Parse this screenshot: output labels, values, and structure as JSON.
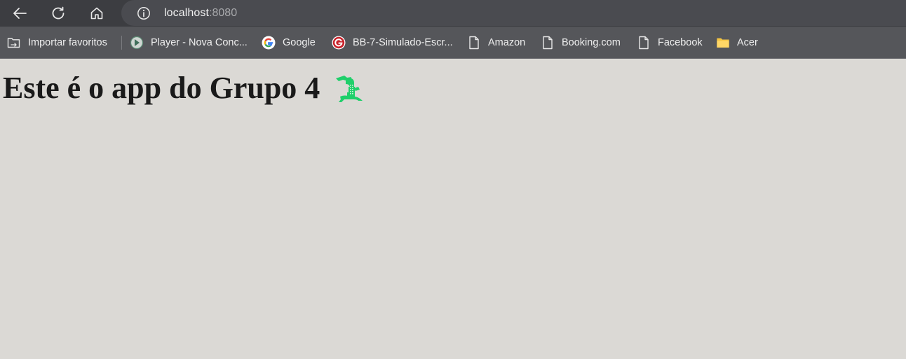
{
  "browser": {
    "url_host": "localhost",
    "url_port": ":8080",
    "icons": {
      "back": "arrow-left-icon",
      "reload": "reload-icon",
      "home": "home-icon",
      "site_info": "info-icon"
    }
  },
  "bookmarks": {
    "items": [
      {
        "label": "Importar favoritos",
        "icon": "import-bookmarks-icon"
      },
      {
        "label": "Player - Nova Conc...",
        "icon": "player-favicon-icon"
      },
      {
        "label": "Google",
        "icon": "google-icon"
      },
      {
        "label": "BB-7-Simulado-Escr...",
        "icon": "g-red-favicon-icon"
      },
      {
        "label": "Amazon",
        "icon": "page-icon"
      },
      {
        "label": "Booking.com",
        "icon": "page-icon"
      },
      {
        "label": "Facebook",
        "icon": "page-icon"
      },
      {
        "label": "Acer",
        "icon": "folder-icon"
      }
    ]
  },
  "page": {
    "heading": "Este é o app do Grupo 4",
    "mascot_icon": "crocodile-icon",
    "mascot_color": "#1fcf6a"
  },
  "colors": {
    "toolbar_bg": "#3c3d41",
    "omnibox_bg": "#4a4b50",
    "bookmarks_bg": "#55565a",
    "page_bg": "#dbd9d5"
  }
}
